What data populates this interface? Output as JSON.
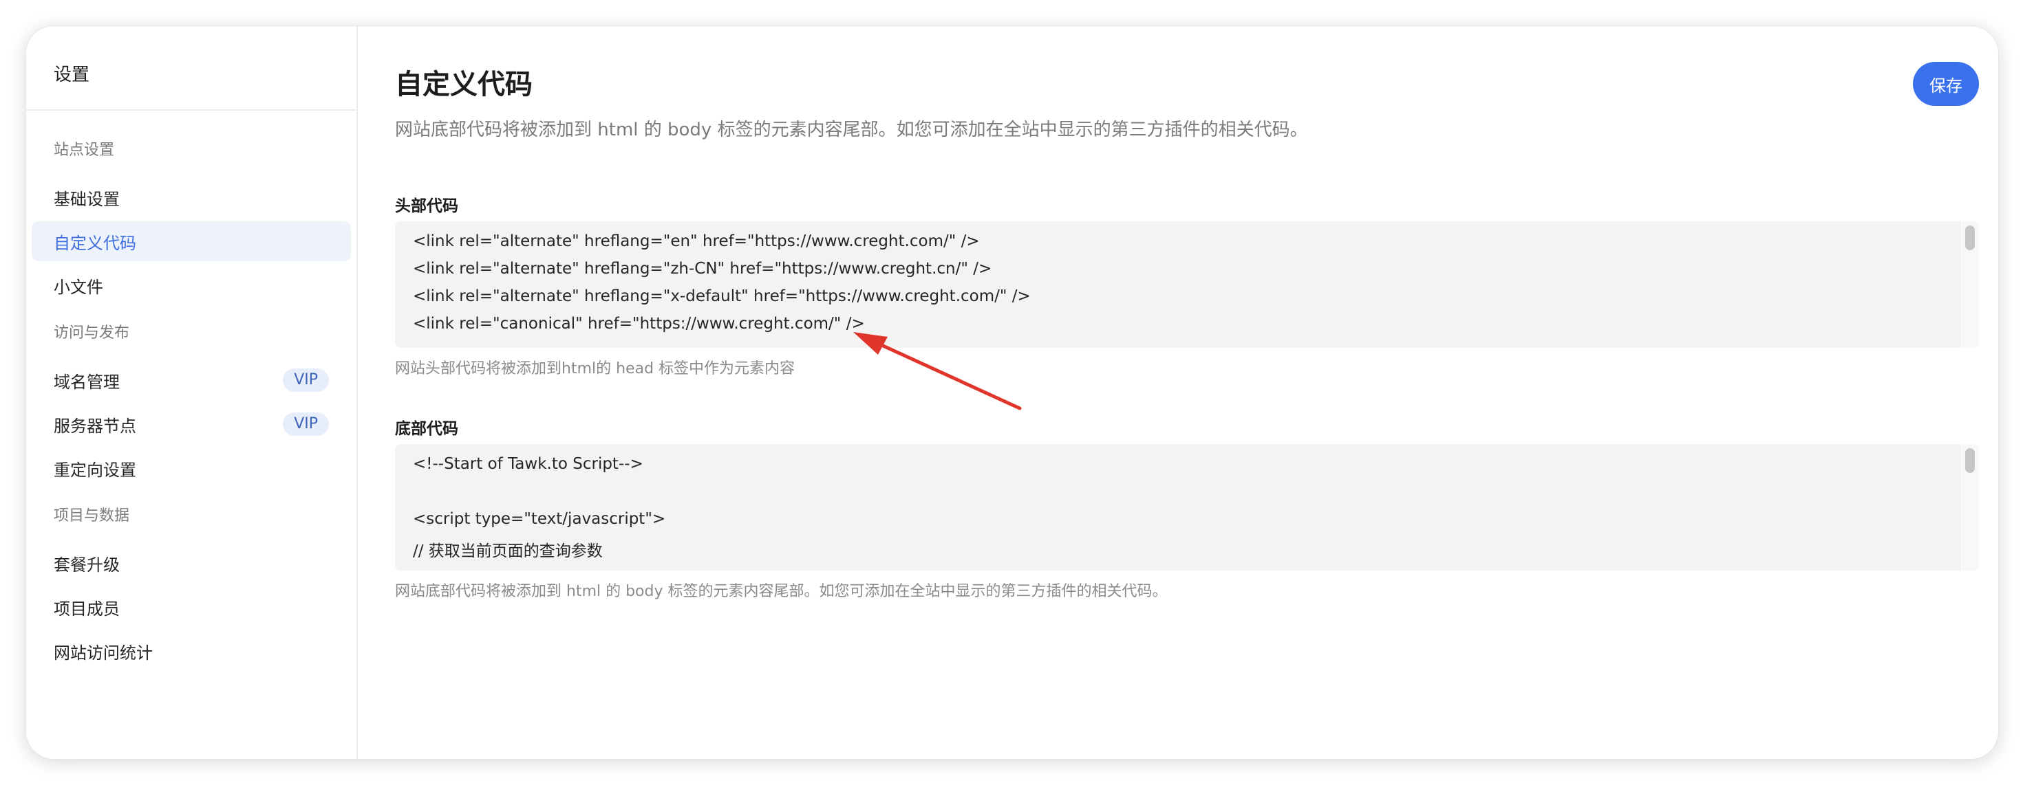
{
  "sidebar": {
    "title": "设置",
    "groups": [
      {
        "label": "站点设置"
      },
      {
        "label": "访问与发布"
      },
      {
        "label": "项目与数据"
      }
    ],
    "items": [
      {
        "label": "基础设置"
      },
      {
        "label": "自定义代码"
      },
      {
        "label": "小文件"
      },
      {
        "label": "域名管理",
        "badge": "VIP"
      },
      {
        "label": "服务器节点",
        "badge": "VIP"
      },
      {
        "label": "重定向设置"
      },
      {
        "label": "套餐升级"
      },
      {
        "label": "项目成员"
      },
      {
        "label": "网站访问统计"
      }
    ]
  },
  "main": {
    "title": "自定义代码",
    "description": "网站底部代码将被添加到 html 的 body 标签的元素内容尾部。如您可添加在全站中显示的第三方插件的相关代码。",
    "save_label": "保存",
    "head_code": {
      "label": "头部代码",
      "lines": [
        "<link rel=\"alternate\" hreflang=\"en\" href=\"https://www.creght.com/\" />",
        "<link rel=\"alternate\" hreflang=\"zh-CN\" href=\"https://www.creght.cn/\" />",
        "<link rel=\"alternate\" hreflang=\"x-default\" href=\"https://www.creght.com/\" />",
        "<link rel=\"canonical\" href=\"https://www.creght.com/\" />"
      ],
      "hint": "网站头部代码将被添加到html的 head 标签中作为元素内容"
    },
    "body_code": {
      "label": "底部代码",
      "lines": [
        "<!--Start of Tawk.to Script-->",
        "",
        "<script type=\"text/javascript\">",
        "// 获取当前页面的查询参数"
      ],
      "hint": "网站底部代码将被添加到 html 的 body 标签的元素内容尾部。如您可添加在全站中显示的第三方插件的相关代码。"
    }
  },
  "colors": {
    "accent": "#3a71ec",
    "active_nav_bg": "#edf2fb",
    "active_nav_text": "#3f6ee0",
    "annotation_arrow": "#e0352b"
  }
}
